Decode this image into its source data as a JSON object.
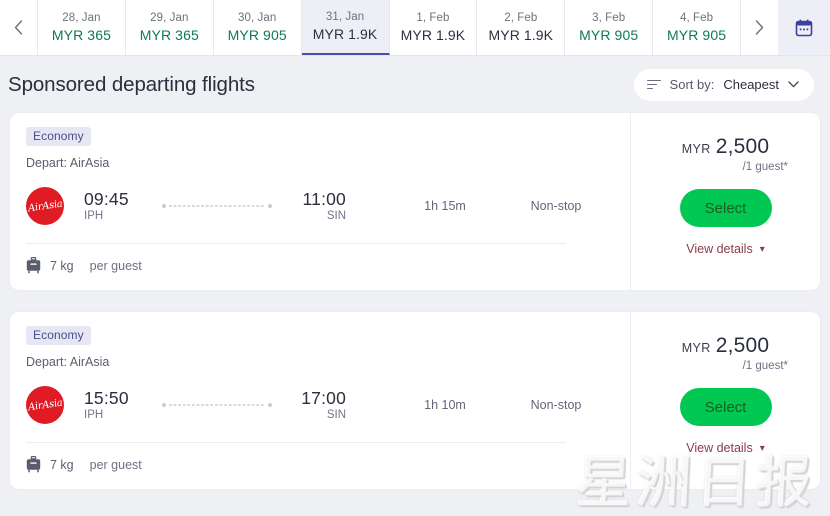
{
  "date_strip": {
    "prev_icon": "chevron-left-icon",
    "next_icon": "chevron-right-icon",
    "calendar_icon": "calendar-icon",
    "tabs": [
      {
        "date": "28, Jan",
        "price": "MYR 365",
        "selected": false,
        "high": false
      },
      {
        "date": "29, Jan",
        "price": "MYR 365",
        "selected": false,
        "high": false
      },
      {
        "date": "30, Jan",
        "price": "MYR 905",
        "selected": false,
        "high": false
      },
      {
        "date": "31, Jan",
        "price": "MYR 1.9K",
        "selected": true,
        "high": true
      },
      {
        "date": "1, Feb",
        "price": "MYR 1.9K",
        "selected": false,
        "high": true
      },
      {
        "date": "2, Feb",
        "price": "MYR 1.9K",
        "selected": false,
        "high": true
      },
      {
        "date": "3, Feb",
        "price": "MYR 905",
        "selected": false,
        "high": false
      },
      {
        "date": "4, Feb",
        "price": "MYR 905",
        "selected": false,
        "high": false
      }
    ]
  },
  "header": {
    "title": "Sponsored departing flights",
    "sort": {
      "icon": "sort-icon",
      "label": "Sort by:",
      "value": "Cheapest",
      "chevron": "chevron-down-icon"
    }
  },
  "flights": [
    {
      "cabin_badge": "Economy",
      "depart_label": "Depart: AirAsia",
      "airline": "AirAsia",
      "airline_logo_text": "AirAsia",
      "depart_time": "09:45",
      "depart_code": "IPH",
      "arrive_time": "11:00",
      "arrive_code": "SIN",
      "duration": "1h 15m",
      "stops": "Non-stop",
      "baggage_icon": "luggage-icon",
      "baggage_weight": "7 kg",
      "baggage_note": "per guest",
      "currency": "MYR",
      "price": "2,500",
      "price_per": "/1 guest*",
      "select_label": "Select",
      "view_details_label": "View details"
    },
    {
      "cabin_badge": "Economy",
      "depart_label": "Depart: AirAsia",
      "airline": "AirAsia",
      "airline_logo_text": "AirAsia",
      "depart_time": "15:50",
      "depart_code": "IPH",
      "arrive_time": "17:00",
      "arrive_code": "SIN",
      "duration": "1h 10m",
      "stops": "Non-stop",
      "baggage_icon": "luggage-icon",
      "baggage_weight": "7 kg",
      "baggage_note": "per guest",
      "currency": "MYR",
      "price": "2,500",
      "price_per": "/1 guest*",
      "select_label": "Select",
      "view_details_label": "View details"
    }
  ],
  "watermark": {
    "text": "星洲日报"
  },
  "colors": {
    "page_bg": "#eff0f4",
    "price_green": "#0f7b4f",
    "select_green": "#00c853",
    "accent_purple": "#4b4ea8",
    "badge_bg": "#e7e7f4",
    "airasia_red": "#e01b24",
    "view_details": "#8c3b4a"
  }
}
